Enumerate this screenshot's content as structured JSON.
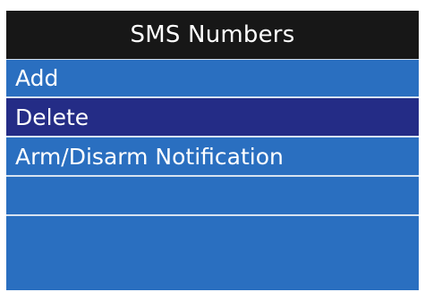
{
  "screen": {
    "title": "SMS Numbers",
    "menu": [
      {
        "label": "Add"
      },
      {
        "label": "Delete"
      },
      {
        "label": "Arm/Disarm Notification"
      },
      {
        "label": ""
      },
      {
        "label": ""
      }
    ],
    "selected_index": 1,
    "colors": {
      "title_bar": "#171717",
      "item_bg": "#2a6fc0",
      "selected_bg": "#242c86",
      "divider": "#d7e3f1",
      "text": "#ffffff"
    }
  }
}
